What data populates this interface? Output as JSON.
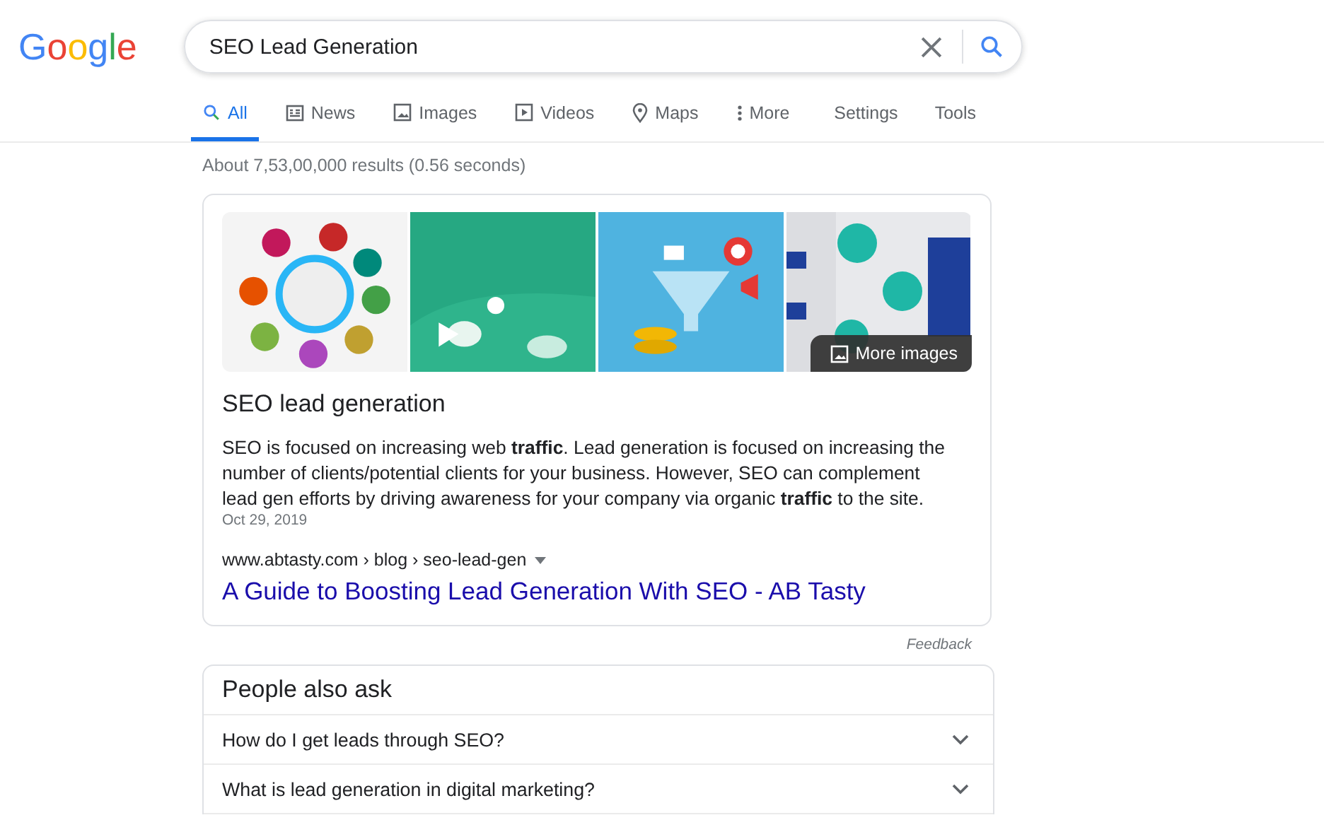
{
  "logo": "Google",
  "search": {
    "value": "SEO Lead Generation"
  },
  "tabs": [
    {
      "label": "All",
      "selected": true
    },
    {
      "label": "News",
      "selected": false
    },
    {
      "label": "Images",
      "selected": false
    },
    {
      "label": "Videos",
      "selected": false
    },
    {
      "label": "Maps",
      "selected": false
    },
    {
      "label": "More",
      "selected": false
    }
  ],
  "tools": [
    "Settings",
    "Tools"
  ],
  "result_stats": "About 7,53,00,000 results (0.56 seconds)",
  "featured_snippet": {
    "more_images": "More images",
    "title": "SEO lead generation",
    "text": "SEO is focused on increasing web **traffic**. Lead generation is focused on increasing the number of clients/potential clients for your business. However, SEO can complement lead gen efforts by driving awareness for your company via organic **traffic** to the site.",
    "date": "Oct 29, 2019",
    "breadcrumb": "www.abtasty.com › blog › seo-lead-gen",
    "link": "A Guide to Boosting Lead Generation With SEO - AB Tasty"
  },
  "feedback": "Feedback",
  "people_also_ask": {
    "title": "People also ask",
    "questions": [
      {
        "text": "How do I get leads through SEO?",
        "expanded": false
      },
      {
        "text": "What is lead generation in digital marketing?",
        "expanded": false
      }
    ]
  }
}
